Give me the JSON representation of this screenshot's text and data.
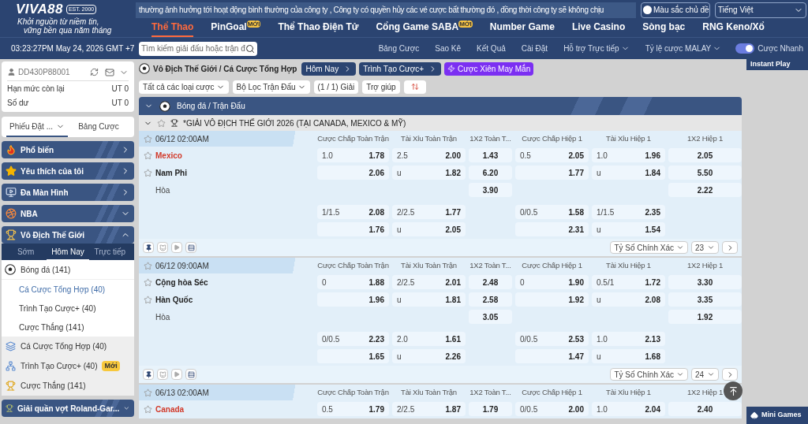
{
  "header": {
    "logo": {
      "brand": "VIVA88",
      "est": "EST. 2000",
      "slogan": [
        "Khởi nguồn từ niềm tin,",
        "vững bền qua năm tháng"
      ]
    },
    "marquee": "thường ảnh hưởng tới hoạt động bình thường của công ty , Công ty có quyền hủy các vé cược bất thường đó , đồng thời công ty sẽ không chịu",
    "theme_select": "Màu sắc chủ đề",
    "language_select": "Tiếng Việt",
    "nav": [
      {
        "label": "Thể Thao",
        "selected": true
      },
      {
        "label": "PinGoal",
        "selected": false,
        "badge": "MỚI"
      },
      {
        "label": "Thể Thao Điện Tử",
        "selected": false
      },
      {
        "label": "Cổng Game SABA",
        "selected": false,
        "badge": "MỚI"
      },
      {
        "label": "Number Game",
        "selected": false
      },
      {
        "label": "Live Casino",
        "selected": false
      },
      {
        "label": "Sòng bạc",
        "selected": false
      },
      {
        "label": "RNG Keno/Xổ",
        "selected": false
      }
    ],
    "clock": "03:23:27PM May 24, 2026 GMT +7",
    "search": {
      "placeholder": "Tìm kiếm giải đấu hoặc trận đ"
    },
    "links": [
      {
        "label": "Bảng Cược",
        "kind": "link"
      },
      {
        "label": "Sao Kê",
        "kind": "link"
      },
      {
        "label": "Kết Quả",
        "kind": "link"
      },
      {
        "label": "Cài Đặt",
        "kind": "link"
      },
      {
        "label": "Hỗ trợ Trực tiếp",
        "kind": "menu"
      },
      {
        "label": "Tỷ lệ cược MALAY",
        "kind": "menu"
      }
    ],
    "quick_bet": {
      "label": "Cược Nhanh",
      "on": true
    }
  },
  "sidebar": {
    "account": {
      "id": "DD430P88001",
      "rows": [
        {
          "label": "Hạn mức còn lại",
          "value": "UT 0"
        },
        {
          "label": "Số dư",
          "value": "UT 0"
        }
      ]
    },
    "tabs": [
      {
        "label": "Phiếu Đặt ...",
        "selected": true
      },
      {
        "label": "Bảng Cược",
        "selected": false
      }
    ],
    "categories": [
      {
        "label": "Phổ biến",
        "kind": "link"
      },
      {
        "label": "Yêu thích của tôi",
        "kind": "link"
      },
      {
        "label": "Đa Màn Hình",
        "kind": "link"
      },
      {
        "label": "NBA",
        "kind": "group",
        "expanded": false
      },
      {
        "label": "Vô Địch Thế Giới",
        "kind": "group",
        "expanded": true,
        "subtabs": [
          {
            "label": "Sớm",
            "selected": false
          },
          {
            "label": "Hôm Nay",
            "selected": true
          },
          {
            "label": "Trực tiếp",
            "selected": false
          }
        ],
        "sport": {
          "label": "Bóng đá",
          "count": "(141)"
        },
        "sport_items": [
          {
            "label": "Cá Cược Tổng Hợp",
            "count": "(40)",
            "selected": true
          },
          {
            "label": "Trình Tạo Cược+",
            "count": "(40)",
            "selected": false
          },
          {
            "label": "Cược Thắng",
            "count": "(141)",
            "selected": false
          }
        ],
        "extra_items": [
          {
            "label": "Cá Cược Tổng Hợp",
            "count": "(40)"
          },
          {
            "label": "Trình Tạo Cược+",
            "count": "(40)",
            "badge": "Mới"
          },
          {
            "label": "Cược Thắng",
            "count": "(141)"
          }
        ]
      },
      {
        "label": "Giải quần vợt Roland-Gar...",
        "kind": "group",
        "expanded": false
      }
    ]
  },
  "main": {
    "breadcrumb": "Vô Địch Thế Giới / Cá Cược Tổng Hợp",
    "top_buttons": [
      {
        "label": "Hôm Nay",
        "kind": "nav"
      },
      {
        "label": "Trình Tạo Cược+",
        "kind": "nav"
      },
      {
        "label": "Cược Xiên May Mắn",
        "kind": "promo"
      }
    ],
    "filters": [
      {
        "label": "Tất cả các loại cược",
        "kind": "dropdown"
      },
      {
        "label": "Bộ Lọc Trận Đấu",
        "kind": "dropdown"
      },
      {
        "label": "(1 / 1) Giải",
        "kind": "button"
      },
      {
        "label": "Trợ giúp",
        "kind": "button"
      }
    ],
    "section": "Bóng đá / Trận Đấu",
    "league": "*GIẢI VÔ ĐỊCH THẾ GIỚI 2026 (TẠI CANADA, MEXICO & MỸ)",
    "matches": [
      {
        "time": "06/12 02:00AM",
        "columns": [
          "Cược Chấp Toàn Trận",
          "Tài Xỉu Toàn Trận",
          "1X2 Toàn T...",
          "Cược Chấp Hiệp 1",
          "Tài Xỉu Hiệp 1",
          "1X2 Hiệp 1"
        ],
        "rows": [
          {
            "kind": "team",
            "label": "Mexico",
            "highlighted": true,
            "cells": [
              {
                "kind": "pair",
                "line": "1.0",
                "odds": "1.78"
              },
              {
                "kind": "pair",
                "line": "2.5",
                "odds": "2.00"
              },
              {
                "kind": "single",
                "odds": "1.43"
              },
              {
                "kind": "pair",
                "line": "0.5",
                "odds": "2.05"
              },
              {
                "kind": "pair",
                "line": "1.0",
                "odds": "1.96"
              },
              {
                "kind": "single",
                "odds": "2.05"
              }
            ]
          },
          {
            "kind": "team",
            "label": "Nam Phi",
            "highlighted": false,
            "cells": [
              {
                "kind": "pair",
                "odds": "2.06"
              },
              {
                "kind": "pair",
                "line": "u",
                "odds": "1.82"
              },
              {
                "kind": "single",
                "odds": "6.20"
              },
              {
                "kind": "pair",
                "odds": "1.77"
              },
              {
                "kind": "pair",
                "line": "u",
                "odds": "1.84"
              },
              {
                "kind": "single",
                "odds": "5.50"
              }
            ]
          },
          {
            "kind": "draw",
            "label": "Hòa",
            "cells": [
              {
                "kind": "empty"
              },
              {
                "kind": "empty"
              },
              {
                "kind": "single",
                "odds": "3.90"
              },
              {
                "kind": "empty"
              },
              {
                "kind": "empty"
              },
              {
                "kind": "single",
                "odds": "2.22"
              }
            ]
          },
          {
            "kind": "extra",
            "cells": [
              {
                "kind": "pair",
                "line": "1/1.5",
                "odds": "2.08"
              },
              {
                "kind": "pair",
                "line": "2/2.5",
                "odds": "1.77"
              },
              {
                "kind": "empty"
              },
              {
                "kind": "pair",
                "line": "0/0.5",
                "odds": "1.58"
              },
              {
                "kind": "pair",
                "line": "1/1.5",
                "odds": "2.35"
              },
              {
                "kind": "empty"
              }
            ]
          },
          {
            "kind": "extra",
            "cells": [
              {
                "kind": "pair",
                "odds": "1.76"
              },
              {
                "kind": "pair",
                "line": "u",
                "odds": "2.05"
              },
              {
                "kind": "empty"
              },
              {
                "kind": "pair",
                "odds": "2.31"
              },
              {
                "kind": "pair",
                "line": "u",
                "odds": "1.54"
              },
              {
                "kind": "empty"
              }
            ]
          }
        ],
        "footer": {
          "market": "Tỷ Số Chính Xác",
          "count": "23"
        }
      },
      {
        "time": "06/12 09:00AM",
        "columns": [
          "Cược Chấp Toàn Trận",
          "Tài Xỉu Toàn Trận",
          "1X2 Toàn T...",
          "Cược Chấp Hiệp 1",
          "Tài Xỉu Hiệp 1",
          "1X2 Hiệp 1"
        ],
        "rows": [
          {
            "kind": "team",
            "label": "Cộng hòa Séc",
            "highlighted": false,
            "cells": [
              {
                "kind": "pair",
                "line": "0",
                "odds": "1.88"
              },
              {
                "kind": "pair",
                "line": "2/2.5",
                "odds": "2.01"
              },
              {
                "kind": "single",
                "odds": "2.48"
              },
              {
                "kind": "pair",
                "line": "0",
                "odds": "1.90"
              },
              {
                "kind": "pair",
                "line": "0.5/1",
                "odds": "1.72"
              },
              {
                "kind": "single",
                "odds": "3.30"
              }
            ]
          },
          {
            "kind": "team",
            "label": "Hàn Quốc",
            "highlighted": false,
            "cells": [
              {
                "kind": "pair",
                "odds": "1.96"
              },
              {
                "kind": "pair",
                "line": "u",
                "odds": "1.81"
              },
              {
                "kind": "single",
                "odds": "2.58"
              },
              {
                "kind": "pair",
                "odds": "1.92"
              },
              {
                "kind": "pair",
                "line": "u",
                "odds": "2.08"
              },
              {
                "kind": "single",
                "odds": "3.35"
              }
            ]
          },
          {
            "kind": "draw",
            "label": "Hòa",
            "cells": [
              {
                "kind": "empty"
              },
              {
                "kind": "empty"
              },
              {
                "kind": "single",
                "odds": "3.05"
              },
              {
                "kind": "empty"
              },
              {
                "kind": "empty"
              },
              {
                "kind": "single",
                "odds": "1.92"
              }
            ]
          },
          {
            "kind": "extra",
            "cells": [
              {
                "kind": "pair",
                "line": "0/0.5",
                "odds": "2.23"
              },
              {
                "kind": "pair",
                "line": "2.0",
                "odds": "1.61"
              },
              {
                "kind": "empty"
              },
              {
                "kind": "pair",
                "line": "0/0.5",
                "odds": "2.53"
              },
              {
                "kind": "pair",
                "line": "1.0",
                "odds": "2.13"
              },
              {
                "kind": "empty"
              }
            ]
          },
          {
            "kind": "extra",
            "cells": [
              {
                "kind": "pair",
                "odds": "1.65"
              },
              {
                "kind": "pair",
                "line": "u",
                "odds": "2.26"
              },
              {
                "kind": "empty"
              },
              {
                "kind": "pair",
                "odds": "1.47"
              },
              {
                "kind": "pair",
                "line": "u",
                "odds": "1.68"
              },
              {
                "kind": "empty"
              }
            ]
          }
        ],
        "footer": {
          "market": "Tỷ Số Chính Xác",
          "count": "24"
        }
      },
      {
        "time": "06/13 02:00AM",
        "columns": [
          "Cược Chấp Toàn Trận",
          "Tài Xỉu Toàn Trận",
          "1X2 Toàn T...",
          "Cược Chấp Hiệp 1",
          "Tài Xỉu Hiệp 1",
          "1X2 Hiệp 1"
        ],
        "rows": [
          {
            "kind": "team",
            "label": "Canada",
            "highlighted": true,
            "cells": [
              {
                "kind": "pair",
                "line": "0.5",
                "odds": "1.79"
              },
              {
                "kind": "pair",
                "line": "2/2.5",
                "odds": "1.87"
              },
              {
                "kind": "single",
                "odds": "1.79"
              },
              {
                "kind": "pair",
                "line": "0/0.5",
                "odds": "2.00"
              },
              {
                "kind": "pair",
                "line": "1.0",
                "odds": "2.04"
              },
              {
                "kind": "single",
                "odds": "2.40"
              }
            ]
          }
        ]
      }
    ]
  },
  "right_panel": {
    "instant_play": "Instant Play",
    "mini_games": "Mini Games"
  }
}
